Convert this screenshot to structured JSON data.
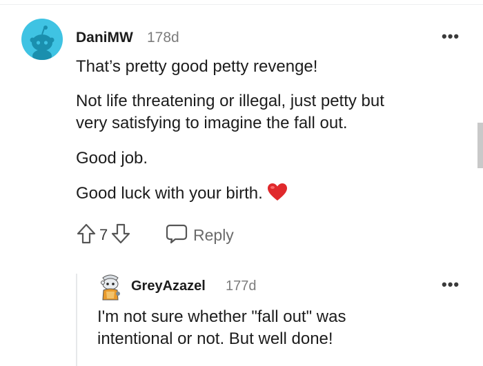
{
  "comment": {
    "author": "DaniMW",
    "age": "178d",
    "more_label": "•••",
    "paragraphs": [
      "That’s pretty good petty revenge!",
      "Not life threatening or illegal, just petty but",
      "very satisfying to imagine the fall out.",
      "Good job.",
      "Good luck with your birth."
    ],
    "emoji": "❤️",
    "vote_count": "7",
    "reply_label": "Reply"
  },
  "reply": {
    "author": "GreyAzazel",
    "age": "177d",
    "more_label": "•••",
    "lines": [
      "I'm not sure whether \"fall out\" was",
      "intentional or not. But well done!"
    ]
  },
  "colors": {
    "avatar_bg": "#3fc3e3",
    "heart": "#e0292c",
    "muted": "#7c7c7c"
  },
  "icons": [
    "snoo-avatar-icon",
    "upvote-arrow-icon",
    "downvote-arrow-icon",
    "comment-bubble-icon",
    "overflow-dots-icon",
    "heart-emoji-icon"
  ]
}
